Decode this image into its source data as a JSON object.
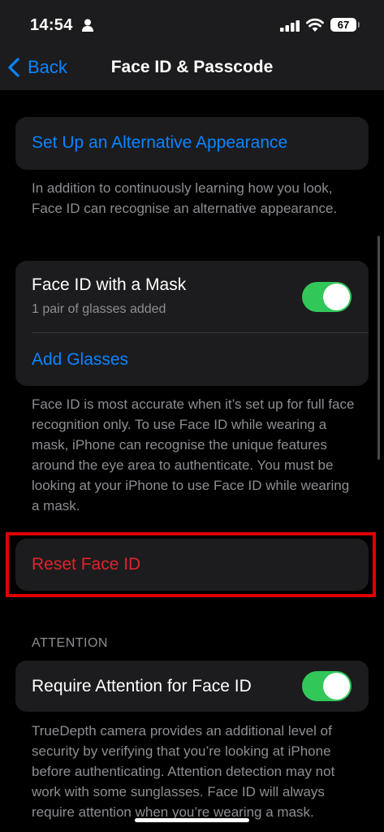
{
  "status_bar": {
    "time": "14:54",
    "battery": "67",
    "icons": [
      "person-icon",
      "signal-icon",
      "wifi-icon",
      "battery-icon"
    ]
  },
  "nav": {
    "back_label": "Back",
    "title": "Face ID & Passcode"
  },
  "alternative_appearance": {
    "label": "Set Up an Alternative Appearance",
    "footnote": "In addition to continuously learning how you look, Face ID can recognise an alternative appearance."
  },
  "mask": {
    "title": "Face ID with a Mask",
    "subtitle": "1 pair of glasses added",
    "toggle_on": true,
    "add_glasses_label": "Add Glasses",
    "footnote": "Face ID is most accurate when it’s set up for full face recognition only. To use Face ID while wearing a mask, iPhone can recognise the unique features around the eye area to authenticate. You must be looking at your iPhone to use Face ID while wearing a mask."
  },
  "reset": {
    "label": "Reset Face ID",
    "color": "#e0232a",
    "highlight_color": "#e00000"
  },
  "attention": {
    "header": "ATTENTION",
    "require_label": "Require Attention for Face ID",
    "toggle_on": true,
    "footnote": "TrueDepth camera provides an additional level of security by verifying that you’re looking at iPhone before authenticating. Attention detection may not work with some sunglasses. Face ID will always require attention when you’re wearing a mask."
  },
  "colors": {
    "accent": "#0a84ff",
    "toggle_on": "#32c759",
    "background": "#000000",
    "card": "#1c1c1e",
    "secondary_text": "#8d8d93"
  }
}
